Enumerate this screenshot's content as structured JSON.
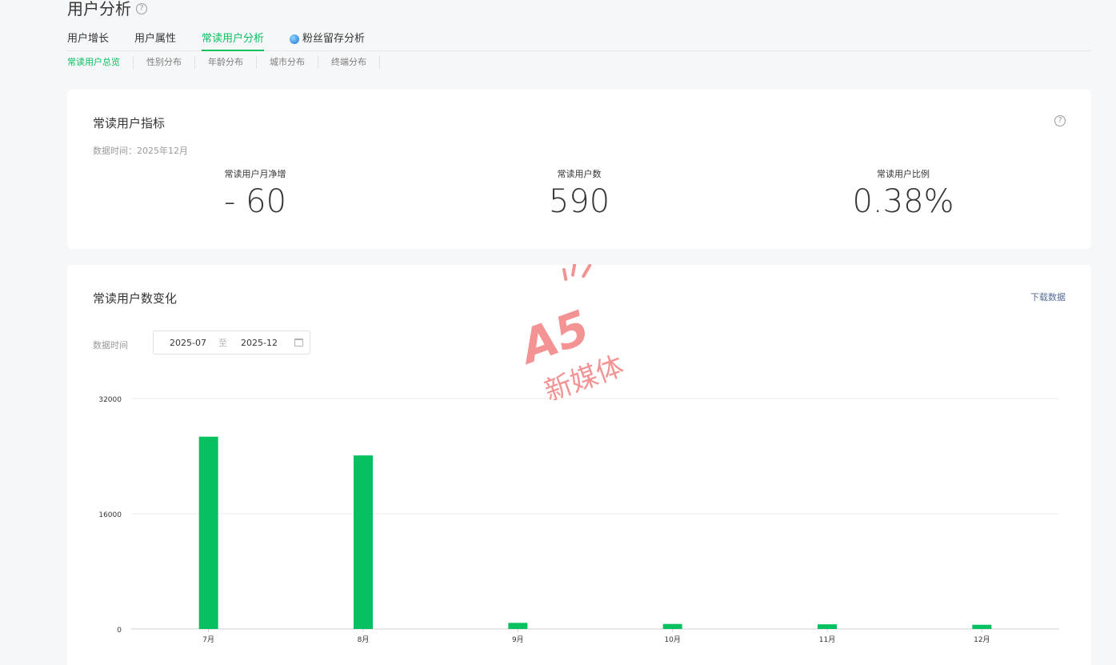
{
  "header": {
    "title": "用户分析"
  },
  "main_tabs": [
    {
      "label": "用户增长"
    },
    {
      "label": "用户属性"
    },
    {
      "label": "常读用户分析"
    },
    {
      "label": "粉丝留存分析"
    }
  ],
  "sub_tabs": [
    {
      "label": "常读用户总览"
    },
    {
      "label": "性别分布"
    },
    {
      "label": "年龄分布"
    },
    {
      "label": "城市分布"
    },
    {
      "label": "终端分布"
    }
  ],
  "metrics_card": {
    "title": "常读用户指标",
    "data_time": "数据时间：2025年12月",
    "metrics": [
      {
        "label": "常读用户月净增",
        "value": "- 60"
      },
      {
        "label": "常读用户数",
        "value": "590"
      },
      {
        "label": "常读用户比例",
        "value": "0.38%"
      }
    ]
  },
  "chart_card": {
    "title": "常读用户数变化",
    "download_label": "下载数据",
    "range_label": "数据时间",
    "date_start": "2025-07",
    "date_separator": "至",
    "date_end": "2025-12"
  },
  "watermark": {
    "brand": "A5",
    "text": "新媒体"
  },
  "colors": {
    "accent": "#07c160",
    "link": "#576b95",
    "watermark": "#f07070"
  },
  "chart_data": {
    "type": "bar",
    "categories": [
      "7月",
      "8月",
      "9月",
      "10月",
      "11月",
      "12月"
    ],
    "values": [
      26700,
      24100,
      850,
      700,
      650,
      590
    ],
    "ylim": [
      0,
      32000
    ],
    "yticks": [
      0,
      16000,
      32000
    ],
    "grid": true,
    "color": "#07c160"
  }
}
